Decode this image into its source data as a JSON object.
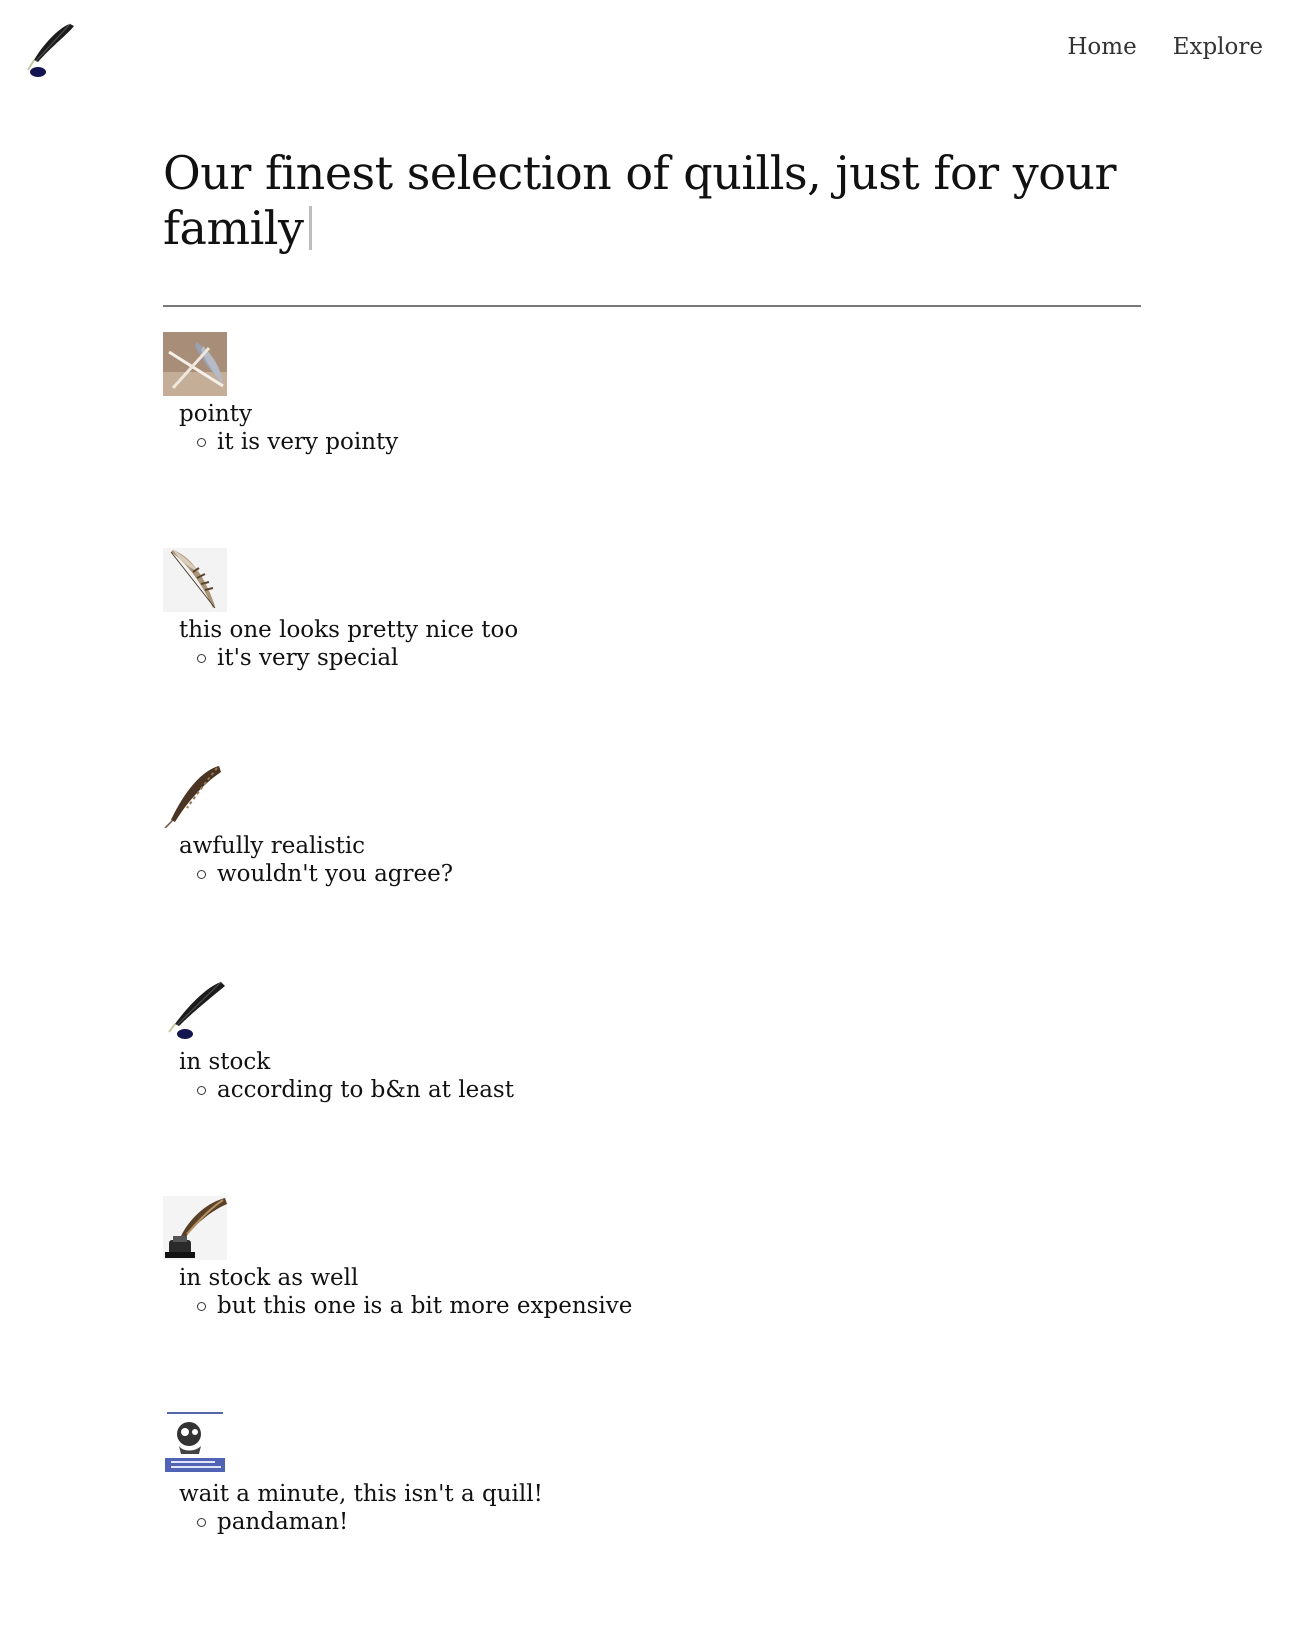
{
  "header": {
    "logo_icon": "quill-ink-icon",
    "nav": [
      {
        "label": "Home"
      },
      {
        "label": "Explore"
      }
    ]
  },
  "hero": {
    "title": "Our finest selection of quills, just for your family"
  },
  "items": [
    {
      "title": "pointy",
      "detail": "it is very pointy",
      "image_icon": "white-quills-photo"
    },
    {
      "title": "this one looks pretty nice too",
      "detail": "it's very special",
      "image_icon": "striped-feather-photo"
    },
    {
      "title": "awfully realistic",
      "detail": "wouldn't you agree?",
      "image_icon": "brown-feather-photo"
    },
    {
      "title": "in stock",
      "detail": "according to b&n at least",
      "image_icon": "black-quill-ink-icon"
    },
    {
      "title": "in stock as well",
      "detail": "but this one is a bit more expensive",
      "image_icon": "quill-inkwell-photo"
    },
    {
      "title": "wait a minute, this isn't a quill!",
      "detail": "pandaman!",
      "image_icon": "book-cover-image"
    }
  ]
}
